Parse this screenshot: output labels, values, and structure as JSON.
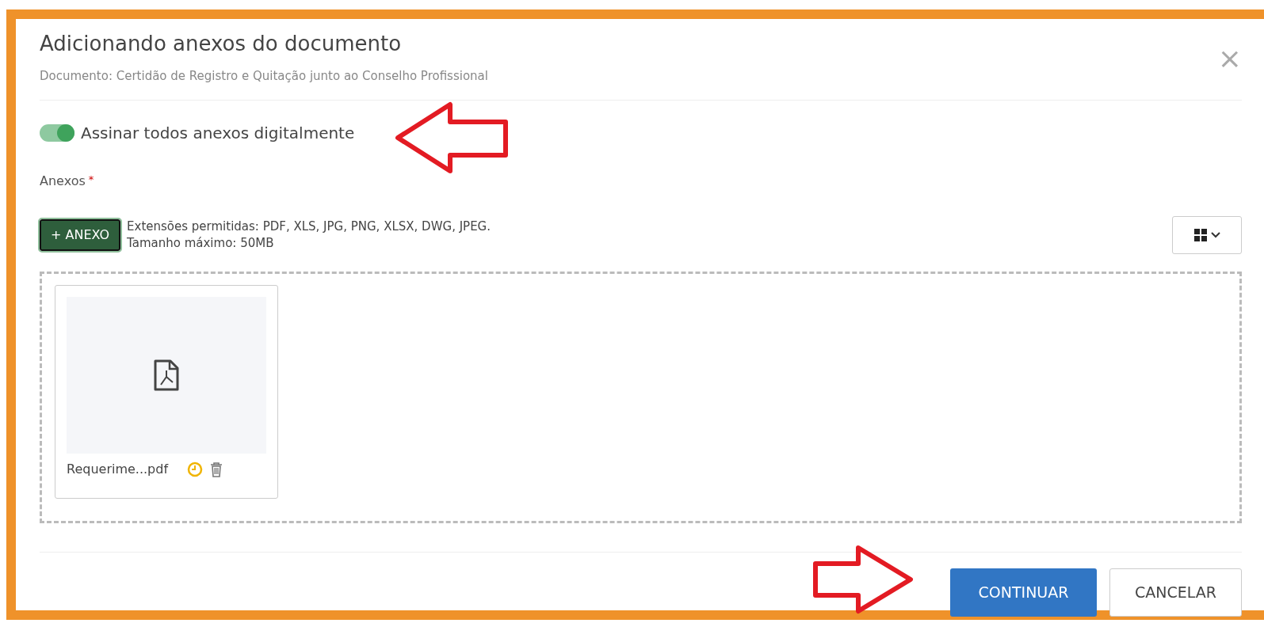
{
  "dialog": {
    "title": "Adicionando anexos do documento",
    "subtitle": "Documento: Certidão de Registro e Quitação junto ao Conselho Profissional",
    "close": "×"
  },
  "sign_toggle": {
    "label": "Assinar todos anexos digitalmente",
    "on": true
  },
  "attachments": {
    "label": "Anexos",
    "required": "*",
    "add_button": "+ ANEXO",
    "extensions": "Extensões permitidas: PDF, XLS, JPG, PNG, XLSX, DWG, JPEG.",
    "max_size": "Tamanho máximo: 50MB",
    "files": [
      {
        "name": "Requerime...pdf",
        "kind": "pdf",
        "pending": true
      }
    ]
  },
  "buttons": [
    {
      "label": "CONTINUAR",
      "kind": "primary"
    },
    {
      "label": "CANCELAR",
      "kind": "secondary"
    }
  ]
}
